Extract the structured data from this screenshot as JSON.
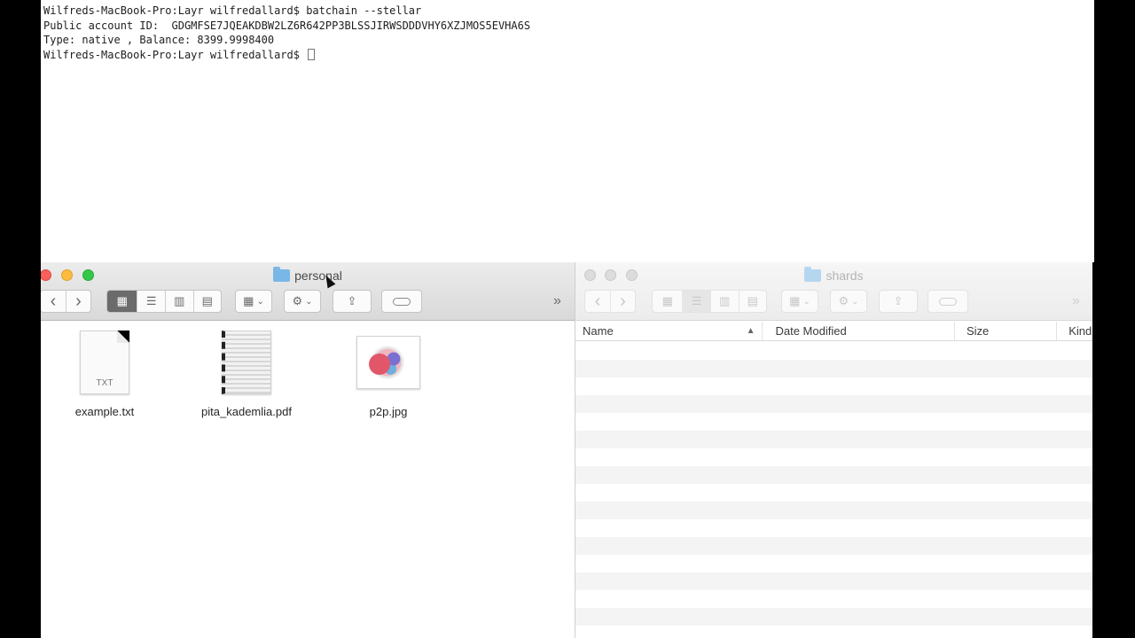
{
  "terminal": {
    "lines": [
      "Wilfreds-MacBook-Pro:Layr wilfredallard$ batchain --stellar",
      "Public account ID:  GDGMFSE7JQEAKDBW2LZ6R642PP3BLSSJIRWSDDDVHY6XZJMOS5EVHA6S",
      "Type: native , Balance: 8399.9998400",
      "Wilfreds-MacBook-Pro:Layr wilfredallard$ "
    ]
  },
  "finder_left": {
    "title": "personal",
    "files": [
      {
        "name": "example.txt",
        "kind": "TXT"
      },
      {
        "name": "pita_kademlia.pdf",
        "kind": "pdf"
      },
      {
        "name": "p2p.jpg",
        "kind": "jpg"
      }
    ],
    "overflow": "»"
  },
  "finder_right": {
    "title": "shards",
    "columns": [
      "Name",
      "Date Modified",
      "Size",
      "Kind"
    ],
    "sort_indicator": "▲",
    "overflow": "»"
  },
  "icons": {
    "back": "‹",
    "forward": "›",
    "action": "⚙",
    "chevron": "⌄"
  },
  "colors": {
    "close": "#fc605b",
    "minimize": "#fdbc40",
    "zoom": "#34c84a",
    "folder": "#79b7e6"
  }
}
